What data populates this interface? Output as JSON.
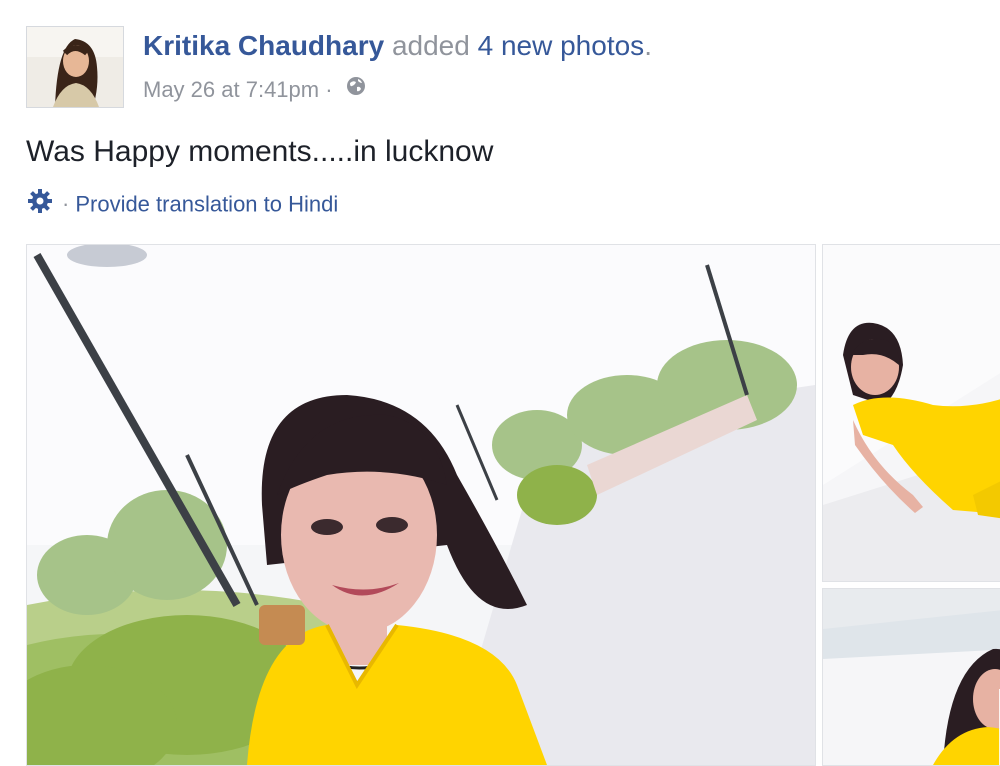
{
  "post": {
    "author_name": "Kritika Chaudhary",
    "action_text": "added",
    "photos_link": "4 new photos",
    "action_suffix": ".",
    "timestamp": "May 26 at 7:41pm",
    "meta_separator": "·",
    "privacy_icon": "globe-icon",
    "body_text": "Was Happy moments.....in lucknow",
    "translate_icon": "gear-icon",
    "translate_separator": "·",
    "translate_link": "Provide translation to Hindi"
  },
  "photos": [
    {
      "id": "photo-1",
      "icon": "photo-image"
    },
    {
      "id": "photo-2",
      "icon": "photo-image"
    },
    {
      "id": "photo-3",
      "icon": "photo-image"
    }
  ],
  "colors": {
    "link": "#365899",
    "muted": "#90949c",
    "text": "#1d2129",
    "dress": "#ffd400"
  }
}
